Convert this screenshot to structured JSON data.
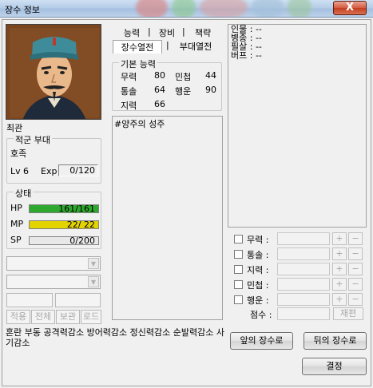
{
  "window": {
    "title": "장수 정보",
    "close_label": "X"
  },
  "general": {
    "name": "최관",
    "unit_section": "적군 부대",
    "unit_name": "호족",
    "level_label": "Lv",
    "level": "6",
    "exp_label": "Exp",
    "exp_value": "0/120"
  },
  "status": {
    "section": "상태",
    "hp_label": "HP",
    "hp_value": "161/161",
    "hp_fraction": 1.0,
    "mp_label": "MP",
    "mp_value": "22/ 22",
    "mp_fraction": 1.0,
    "sp_label": "SP",
    "sp_value": "0/200",
    "sp_fraction": 0.0
  },
  "left_buttons": [
    "적용",
    "전체",
    "보관",
    "로드"
  ],
  "tabs": {
    "row1": [
      "능력",
      "장비",
      "책략"
    ],
    "row2": [
      "장수열전",
      "부대열전"
    ]
  },
  "base_stats": {
    "section": "기본 능력",
    "items": [
      {
        "label": "무력",
        "value": "80"
      },
      {
        "label": "민첩",
        "value": "44"
      },
      {
        "label": "통솔",
        "value": "64"
      },
      {
        "label": "행운",
        "value": "90"
      },
      {
        "label": "지력",
        "value": "66"
      }
    ]
  },
  "biography": "#양주의 성주",
  "right_info": [
    {
      "label": "인물",
      "value": ": --"
    },
    {
      "label": "병종",
      "value": ": --"
    },
    {
      "label": "필살",
      "value": ": --"
    },
    {
      "label": "버프",
      "value": ": --"
    }
  ],
  "stat_options": {
    "items": [
      "무력 :",
      "통솔 :",
      "지력 :",
      "민첩 :",
      "행운 :"
    ],
    "plus": "+",
    "minus": "−",
    "points_label": "점수 :",
    "reset_label": "재편"
  },
  "effects_text": "혼란 부동 공격력감소 방어력감소 정신력감소 순발력감소 사기감소",
  "buttons": {
    "prev": "앞의 장수로",
    "next": "뒤의 장수로",
    "confirm": "결정"
  },
  "colors": {
    "hp_bar": "#2fa82f",
    "mp_bar": "#e3d300",
    "titlebar": "#b3cbe6",
    "close": "#c94a2e"
  }
}
